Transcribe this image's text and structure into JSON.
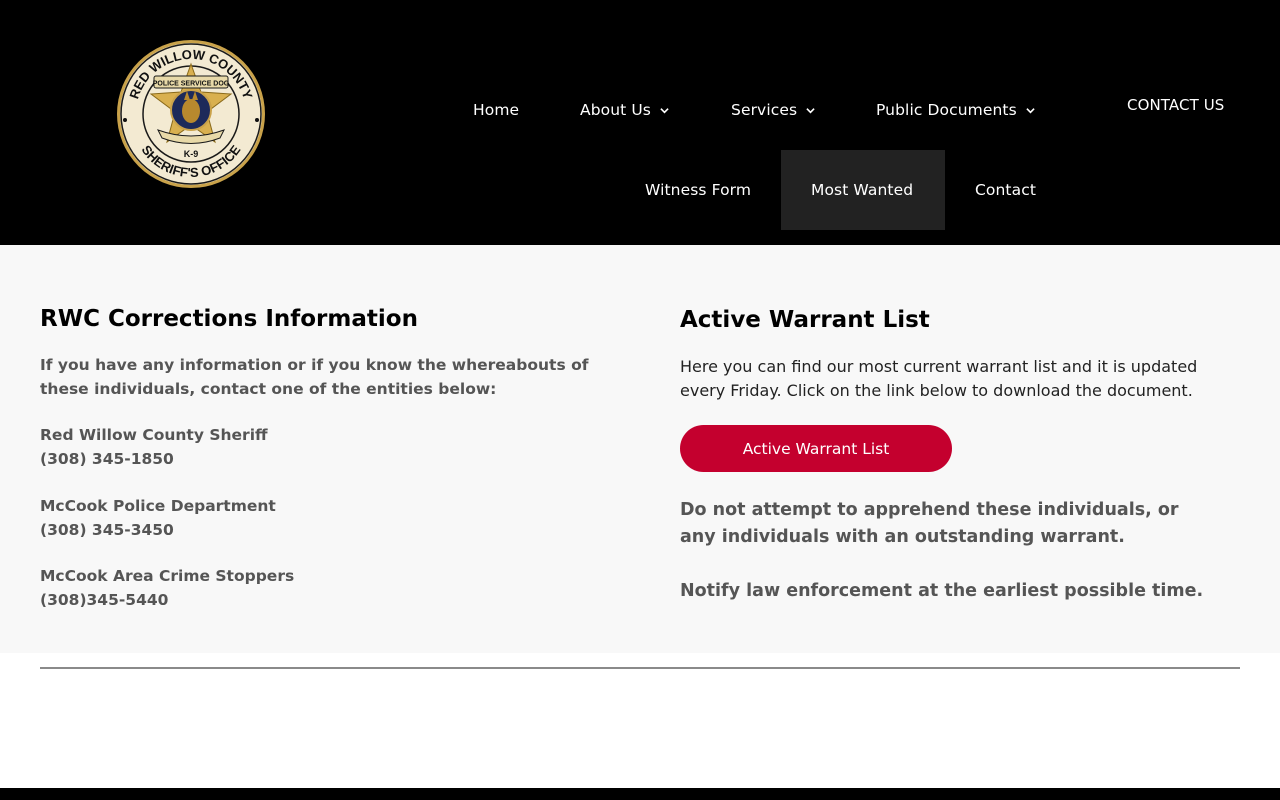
{
  "logo": {
    "top_text": "RED WILLOW COUNTY",
    "bottom_text": "SHERIFF'S OFFICE",
    "banner_text": "POLICE SERVICE DOG",
    "badge_text": "K-9"
  },
  "nav": {
    "home": "Home",
    "about": "About Us",
    "services": "Services",
    "public_documents": "Public Documents",
    "witness_form": "Witness Form",
    "most_wanted": "Most Wanted",
    "contact": "Contact",
    "contact_us": "CONTACT US"
  },
  "left": {
    "title": "RWC Corrections Information",
    "intro": "If you have any information or if you know the whereabouts of these individuals, contact one of the entities below:",
    "entities": [
      {
        "name": "Red Willow County Sheriff",
        "phone": "(308) 345-1850"
      },
      {
        "name": "McCook Police Department",
        "phone": "(308) 345-3450"
      },
      {
        "name": "McCook Area Crime Stoppers",
        "phone": "(308)345-5440"
      }
    ]
  },
  "right": {
    "title": "Active Warrant List",
    "description": "Here you can find our most current warrant list and it is updated every Friday. Click on the link below to download the document.",
    "button_label": "Active Warrant List",
    "warning": "Do not attempt to apprehend these individuals, or any individuals with an outstanding warrant.",
    "notify": "Notify law enforcement at the earliest possible time."
  },
  "colors": {
    "header_bg": "#000000",
    "content_bg": "#f8f8f8",
    "accent_button": "#c4002e",
    "active_nav_bg": "#222222",
    "text_gray": "#555555"
  }
}
